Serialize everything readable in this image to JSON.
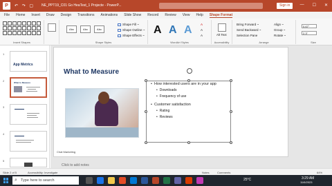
{
  "titlebar": {
    "logo_letter": "P",
    "quick_access": "↶ ↷ ▢",
    "document": "NE_PPT19_C01 Go HeaTest_1 Projecte - PowerP...",
    "signin": "Sign in",
    "window_controls": [
      "—",
      "☐",
      "✕"
    ]
  },
  "tabs": [
    {
      "label": "File"
    },
    {
      "label": "Home"
    },
    {
      "label": "Insert"
    },
    {
      "label": "Draw"
    },
    {
      "label": "Design"
    },
    {
      "label": "Transitions"
    },
    {
      "label": "Animations"
    },
    {
      "label": "Slide Show"
    },
    {
      "label": "Record"
    },
    {
      "label": "Review"
    },
    {
      "label": "View"
    },
    {
      "label": "Help"
    },
    {
      "label": "Shape Format"
    }
  ],
  "ribbon": {
    "groups": {
      "insert_shapes": "Insert Shapes",
      "shape_styles": "Shape Styles",
      "wordart_styles": "WordArt Styles",
      "accessibility": "Accessibility",
      "arrange": "Arrange",
      "size": "Size"
    },
    "style_thumbs": [
      "Abc",
      "Abc",
      "Abc"
    ],
    "shape_fill": "Shape Fill ~",
    "shape_outline": "Shape Outline ~",
    "shape_effects": "Shape Effects ~",
    "wordart_letters": [
      "A",
      "A",
      "A"
    ],
    "alt_text": "Alt Text",
    "bring_forward": "Bring Forward ~",
    "send_backward": "Send Backward ~",
    "selection_pane": "Selection Pane",
    "align": "Align ~",
    "group": "Group ~",
    "rotate": "Rotate ~",
    "height": "0.67\"",
    "width": "2.3\""
  },
  "thumbnails": [
    {
      "num": "1",
      "title": "App Metrics"
    },
    {
      "num": "2",
      "title": "What to Measure"
    },
    {
      "num": "3",
      "title": ""
    },
    {
      "num": "4",
      "title": ""
    },
    {
      "num": "5",
      "title": ""
    }
  ],
  "slide": {
    "title": "What to Measure",
    "bullets": [
      {
        "level": 1,
        "text": "How interested users are in your app"
      },
      {
        "level": 2,
        "text": "Downloads"
      },
      {
        "level": 2,
        "text": "Frequency of use"
      },
      {
        "level": 1,
        "text": "Customer satisfaction"
      },
      {
        "level": 2,
        "text": "Rating"
      },
      {
        "level": 2,
        "text": "Reviews"
      }
    ],
    "footer": "Chat Marketing"
  },
  "notes_placeholder": "Click to add notes",
  "statusbar": {
    "slide_counter": "Slide 2 of 5",
    "accessibility": "Accessibility: Investigate",
    "notes": "Notes",
    "comments": "Comments",
    "zoom": "64%"
  },
  "taskbar": {
    "search_placeholder": "Type here to search",
    "weather": "25°C",
    "time": "3:29 AM",
    "date": "11/6/2023"
  }
}
